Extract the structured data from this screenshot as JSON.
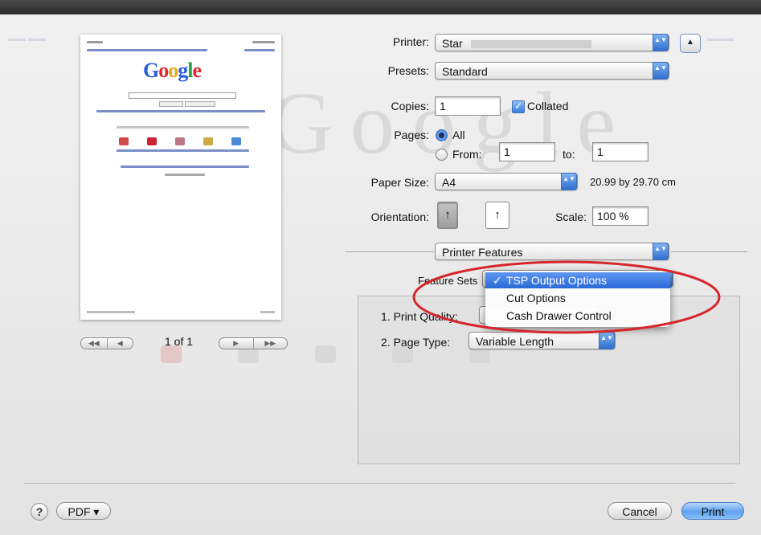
{
  "preview": {
    "logo_letters": [
      "G",
      "o",
      "o",
      "g",
      "l",
      "e"
    ],
    "page_indicator": "1 of 1",
    "nav_first_prev": [
      "◀◀",
      "◀"
    ],
    "nav_next_last": [
      "▶",
      "▶▶"
    ]
  },
  "printer": {
    "label": "Printer:",
    "value": "Star",
    "up_button": "▲"
  },
  "presets": {
    "label": "Presets:",
    "value": "Standard"
  },
  "copies": {
    "label": "Copies:",
    "value": "1",
    "collated_label": "Collated",
    "collated_checked": true
  },
  "pages": {
    "label": "Pages:",
    "all_label": "All",
    "from_label": "From:",
    "from_value": "1",
    "to_label": "to:",
    "to_value": "1"
  },
  "paper": {
    "label": "Paper Size:",
    "value": "A4",
    "dimensions": "20.99 by 29.70 cm"
  },
  "orientation": {
    "label": "Orientation:",
    "portrait_glyph": "↑",
    "landscape_glyph": "↑"
  },
  "scale": {
    "label": "Scale:",
    "value": "100 %"
  },
  "section_popup": {
    "value": "Printer Features"
  },
  "feature_sets": {
    "label": "Feature Sets",
    "options": [
      {
        "label": "TSP Output Options",
        "selected": true,
        "check": "✓"
      },
      {
        "label": "Cut Options",
        "selected": false,
        "check": ""
      },
      {
        "label": "Cash Drawer Control",
        "selected": false,
        "check": ""
      }
    ]
  },
  "print_quality": {
    "label": "1. Print Quality:"
  },
  "page_type": {
    "label": "2. Page Type:",
    "value": "Variable Length"
  },
  "footer": {
    "help": "?",
    "pdf_label": "PDF ▾",
    "cancel_label": "Cancel",
    "print_label": "Print"
  },
  "arrows": {
    "updown": "▲▼"
  },
  "colors": {
    "highlight_ellipse": "#d6262b",
    "menu_selection": "#2a68d8",
    "primary_button": "#5fa2ee"
  }
}
